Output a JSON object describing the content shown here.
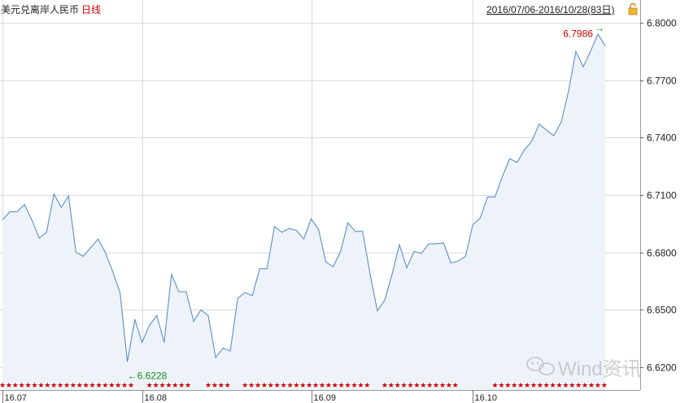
{
  "header": {
    "title": "美元兑离岸人民币",
    "period": "日线",
    "range": "2016/07/06-2016/10/28(83日)"
  },
  "watermark": {
    "text": "Wind资讯"
  },
  "colors": {
    "line": "#5b8ec9",
    "fill": "#eef3fa",
    "grid": "#d9d9d9",
    "marker": "#cc0000",
    "annotation": "#1a8a1a"
  },
  "chart_data": {
    "type": "area",
    "title": "美元兑离岸人民币",
    "ylim": [
      6.6,
      6.806
    ],
    "y_ticks": [
      "6.8000",
      "6.7700",
      "6.7400",
      "6.7100",
      "6.6800",
      "6.6500",
      "6.6200"
    ],
    "y_tick_values": [
      6.8,
      6.77,
      6.74,
      6.71,
      6.68,
      6.65,
      6.62
    ],
    "x_ticks": [
      {
        "label": "16.07",
        "index": 0
      },
      {
        "label": "16.08",
        "index": 19
      },
      {
        "label": "16.09",
        "index": 42
      },
      {
        "label": "16.10",
        "index": 64
      }
    ],
    "series": [
      {
        "values": [
          6.697,
          6.7012,
          6.7012,
          6.705,
          6.697,
          6.6875,
          6.6905,
          6.7105,
          6.7035,
          6.7095,
          6.68,
          6.678,
          6.6825,
          6.687,
          6.68,
          6.67,
          6.659,
          6.6228,
          6.645,
          6.633,
          6.642,
          6.647,
          6.633,
          6.6685,
          6.6595,
          6.6595,
          6.644,
          6.65,
          6.647,
          6.625,
          6.63,
          6.6285,
          6.656,
          6.659,
          6.6575,
          6.6715,
          6.6715,
          6.6935,
          6.6905,
          6.6925,
          6.6915,
          6.687,
          6.6975,
          6.692,
          6.675,
          6.6725,
          6.6805,
          6.6955,
          6.691,
          6.691,
          6.669,
          6.6495,
          6.655,
          6.6685,
          6.684,
          6.672,
          6.6805,
          6.6795,
          6.6845,
          6.6845,
          6.685,
          6.6745,
          6.6755,
          6.678,
          6.6945,
          6.698,
          6.709,
          6.709,
          6.7195,
          6.729,
          6.727,
          6.7335,
          6.738,
          6.747,
          6.744,
          6.741,
          6.748,
          6.764,
          6.785,
          6.777,
          6.785,
          6.794,
          6.788
        ]
      }
    ],
    "annotations": [
      {
        "text": "6.7986",
        "arrow": "→",
        "index": 81,
        "value": 6.7986,
        "kind": "max"
      },
      {
        "text": "6.6228",
        "arrow": "←",
        "index": 17,
        "value": 6.6228,
        "kind": "min"
      }
    ],
    "grid": true,
    "marker_segments": [
      [
        0,
        18
      ],
      [
        20,
        26
      ],
      [
        28,
        31
      ],
      [
        33,
        50
      ],
      [
        52,
        62
      ],
      [
        67,
        82
      ]
    ]
  }
}
